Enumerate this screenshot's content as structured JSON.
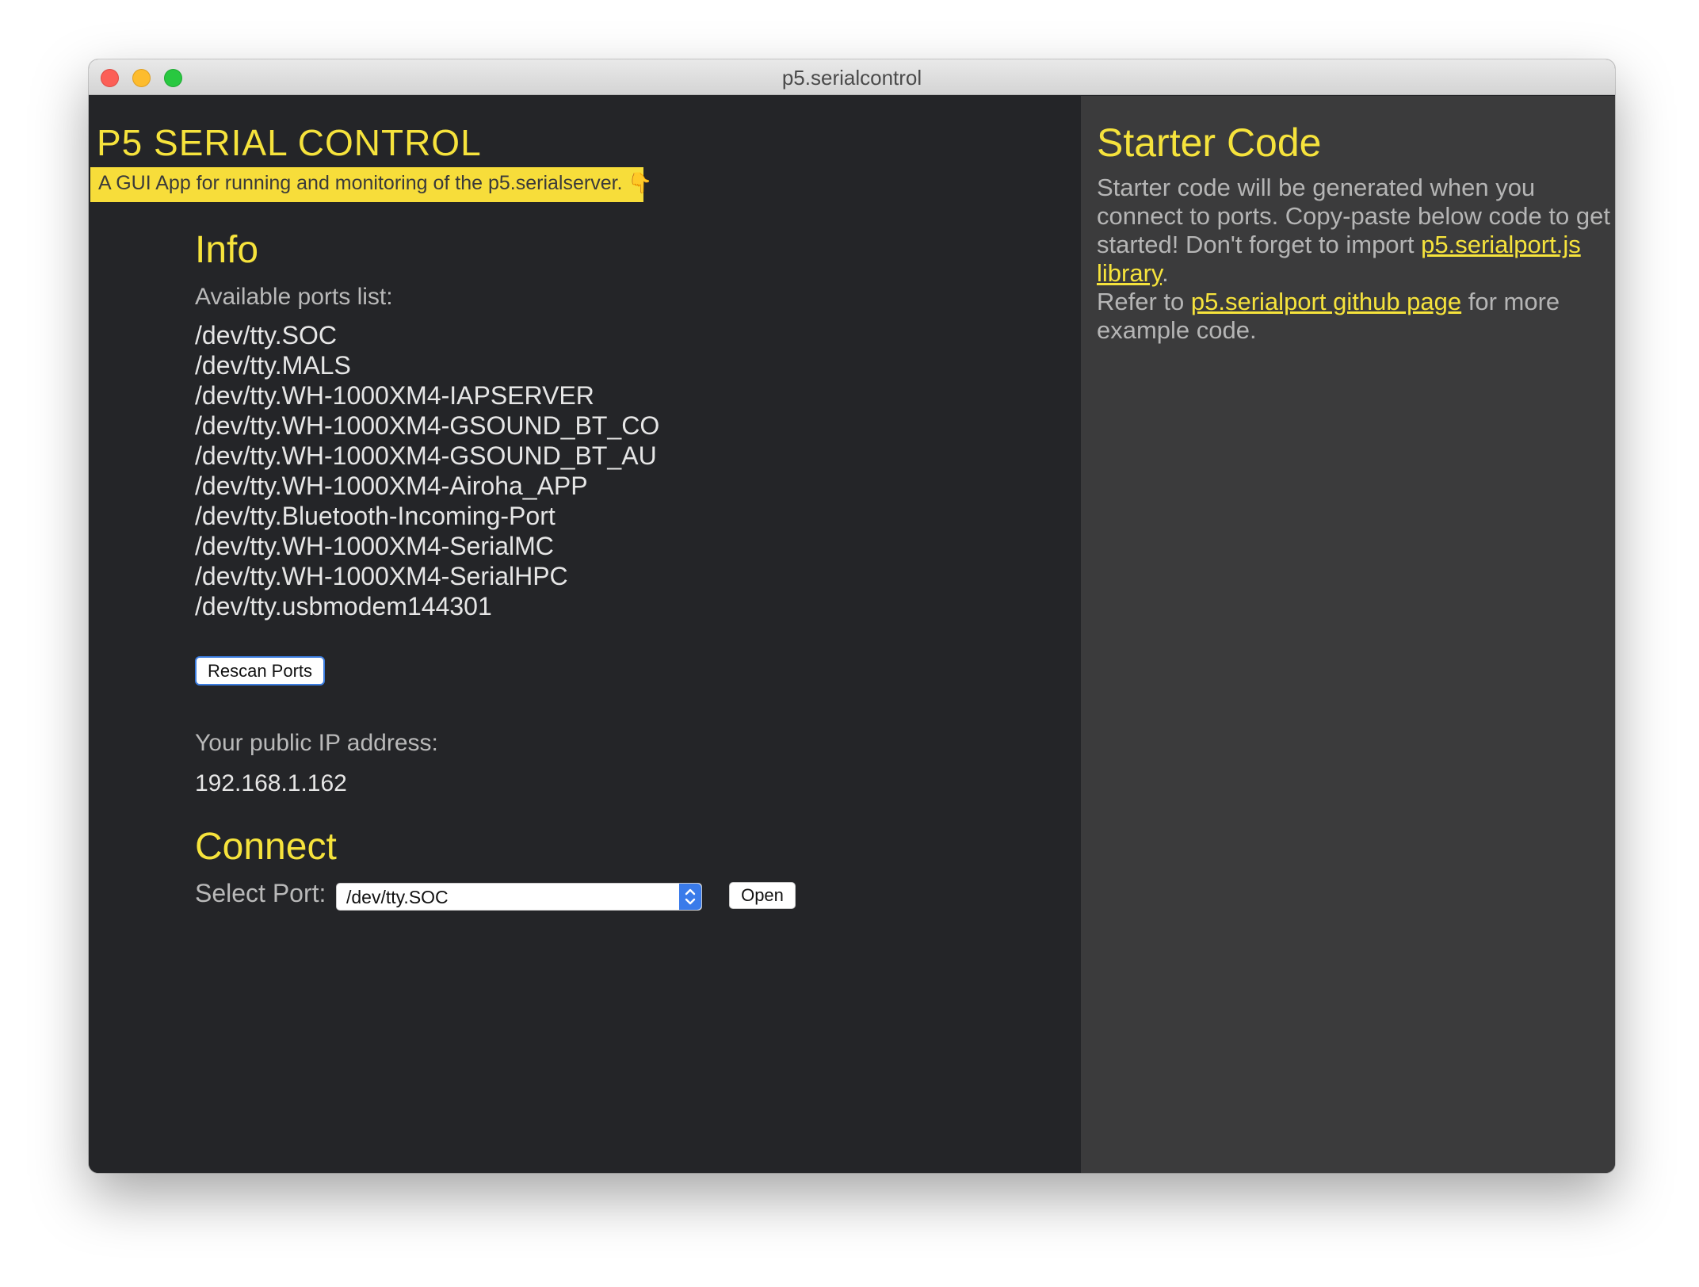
{
  "window": {
    "title": "p5.serialcontrol"
  },
  "app": {
    "title": "P5 SERIAL CONTROL",
    "tagline": "A GUI App for running and monitoring of the p5.serialserver. 👇"
  },
  "info": {
    "heading": "Info",
    "ports_label": "Available ports list:",
    "ports": [
      "/dev/tty.SOC",
      "/dev/tty.MALS",
      "/dev/tty.WH-1000XM4-IAPSERVER",
      "/dev/tty.WH-1000XM4-GSOUND_BT_CO",
      "/dev/tty.WH-1000XM4-GSOUND_BT_AU",
      "/dev/tty.WH-1000XM4-Airoha_APP",
      "/dev/tty.Bluetooth-Incoming-Port",
      "/dev/tty.WH-1000XM4-SerialMC",
      "/dev/tty.WH-1000XM4-SerialHPC",
      "/dev/tty.usbmodem144301"
    ],
    "rescan_label": "Rescan Ports",
    "ip_label": "Your public IP address:",
    "ip_value": "192.168.1.162"
  },
  "connect": {
    "heading": "Connect",
    "select_label": "Select Port:",
    "selected_port": "/dev/tty.SOC",
    "open_label": "Open"
  },
  "starter": {
    "heading": "Starter Code",
    "para1_text": "Starter code will be generated when you connect to ports. Copy-paste below code to get started! Don't forget to import ",
    "para1_link": "p5.serialport.js library",
    "para1_end": ".",
    "para2_start": "Refer to ",
    "para2_link": "p5.serialport github page",
    "para2_end": " for more example code."
  },
  "colors": {
    "accent_yellow": "#f6e33c",
    "left_bg": "#242528",
    "right_bg": "#3b3b3c",
    "select_blue": "#3a7bea"
  },
  "icons": {
    "close": "close-traffic-light-icon",
    "minimize": "minimize-traffic-light-icon",
    "maximize": "maximize-traffic-light-icon",
    "select_arrows": "chevron-up-down-icon"
  }
}
